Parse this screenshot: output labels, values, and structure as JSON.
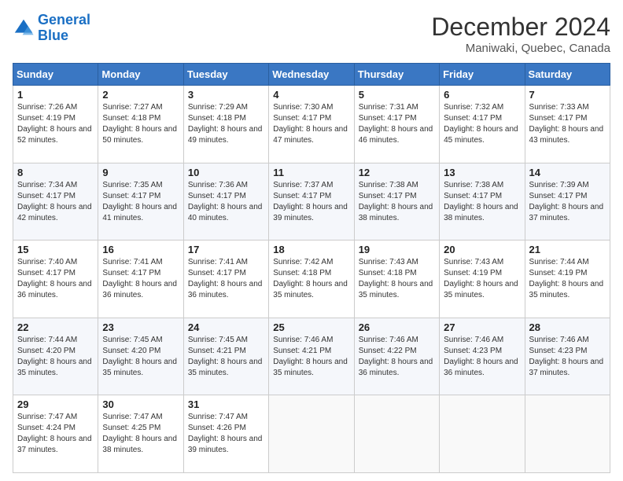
{
  "header": {
    "logo_line1": "General",
    "logo_line2": "Blue",
    "month": "December 2024",
    "location": "Maniwaki, Quebec, Canada"
  },
  "days_of_week": [
    "Sunday",
    "Monday",
    "Tuesday",
    "Wednesday",
    "Thursday",
    "Friday",
    "Saturday"
  ],
  "weeks": [
    [
      {
        "day": "1",
        "sunrise": "7:26 AM",
        "sunset": "4:19 PM",
        "daylight": "8 hours and 52 minutes."
      },
      {
        "day": "2",
        "sunrise": "7:27 AM",
        "sunset": "4:18 PM",
        "daylight": "8 hours and 50 minutes."
      },
      {
        "day": "3",
        "sunrise": "7:29 AM",
        "sunset": "4:18 PM",
        "daylight": "8 hours and 49 minutes."
      },
      {
        "day": "4",
        "sunrise": "7:30 AM",
        "sunset": "4:17 PM",
        "daylight": "8 hours and 47 minutes."
      },
      {
        "day": "5",
        "sunrise": "7:31 AM",
        "sunset": "4:17 PM",
        "daylight": "8 hours and 46 minutes."
      },
      {
        "day": "6",
        "sunrise": "7:32 AM",
        "sunset": "4:17 PM",
        "daylight": "8 hours and 45 minutes."
      },
      {
        "day": "7",
        "sunrise": "7:33 AM",
        "sunset": "4:17 PM",
        "daylight": "8 hours and 43 minutes."
      }
    ],
    [
      {
        "day": "8",
        "sunrise": "7:34 AM",
        "sunset": "4:17 PM",
        "daylight": "8 hours and 42 minutes."
      },
      {
        "day": "9",
        "sunrise": "7:35 AM",
        "sunset": "4:17 PM",
        "daylight": "8 hours and 41 minutes."
      },
      {
        "day": "10",
        "sunrise": "7:36 AM",
        "sunset": "4:17 PM",
        "daylight": "8 hours and 40 minutes."
      },
      {
        "day": "11",
        "sunrise": "7:37 AM",
        "sunset": "4:17 PM",
        "daylight": "8 hours and 39 minutes."
      },
      {
        "day": "12",
        "sunrise": "7:38 AM",
        "sunset": "4:17 PM",
        "daylight": "8 hours and 38 minutes."
      },
      {
        "day": "13",
        "sunrise": "7:38 AM",
        "sunset": "4:17 PM",
        "daylight": "8 hours and 38 minutes."
      },
      {
        "day": "14",
        "sunrise": "7:39 AM",
        "sunset": "4:17 PM",
        "daylight": "8 hours and 37 minutes."
      }
    ],
    [
      {
        "day": "15",
        "sunrise": "7:40 AM",
        "sunset": "4:17 PM",
        "daylight": "8 hours and 36 minutes."
      },
      {
        "day": "16",
        "sunrise": "7:41 AM",
        "sunset": "4:17 PM",
        "daylight": "8 hours and 36 minutes."
      },
      {
        "day": "17",
        "sunrise": "7:41 AM",
        "sunset": "4:17 PM",
        "daylight": "8 hours and 36 minutes."
      },
      {
        "day": "18",
        "sunrise": "7:42 AM",
        "sunset": "4:18 PM",
        "daylight": "8 hours and 35 minutes."
      },
      {
        "day": "19",
        "sunrise": "7:43 AM",
        "sunset": "4:18 PM",
        "daylight": "8 hours and 35 minutes."
      },
      {
        "day": "20",
        "sunrise": "7:43 AM",
        "sunset": "4:19 PM",
        "daylight": "8 hours and 35 minutes."
      },
      {
        "day": "21",
        "sunrise": "7:44 AM",
        "sunset": "4:19 PM",
        "daylight": "8 hours and 35 minutes."
      }
    ],
    [
      {
        "day": "22",
        "sunrise": "7:44 AM",
        "sunset": "4:20 PM",
        "daylight": "8 hours and 35 minutes."
      },
      {
        "day": "23",
        "sunrise": "7:45 AM",
        "sunset": "4:20 PM",
        "daylight": "8 hours and 35 minutes."
      },
      {
        "day": "24",
        "sunrise": "7:45 AM",
        "sunset": "4:21 PM",
        "daylight": "8 hours and 35 minutes."
      },
      {
        "day": "25",
        "sunrise": "7:46 AM",
        "sunset": "4:21 PM",
        "daylight": "8 hours and 35 minutes."
      },
      {
        "day": "26",
        "sunrise": "7:46 AM",
        "sunset": "4:22 PM",
        "daylight": "8 hours and 36 minutes."
      },
      {
        "day": "27",
        "sunrise": "7:46 AM",
        "sunset": "4:23 PM",
        "daylight": "8 hours and 36 minutes."
      },
      {
        "day": "28",
        "sunrise": "7:46 AM",
        "sunset": "4:23 PM",
        "daylight": "8 hours and 37 minutes."
      }
    ],
    [
      {
        "day": "29",
        "sunrise": "7:47 AM",
        "sunset": "4:24 PM",
        "daylight": "8 hours and 37 minutes."
      },
      {
        "day": "30",
        "sunrise": "7:47 AM",
        "sunset": "4:25 PM",
        "daylight": "8 hours and 38 minutes."
      },
      {
        "day": "31",
        "sunrise": "7:47 AM",
        "sunset": "4:26 PM",
        "daylight": "8 hours and 39 minutes."
      },
      null,
      null,
      null,
      null
    ]
  ]
}
